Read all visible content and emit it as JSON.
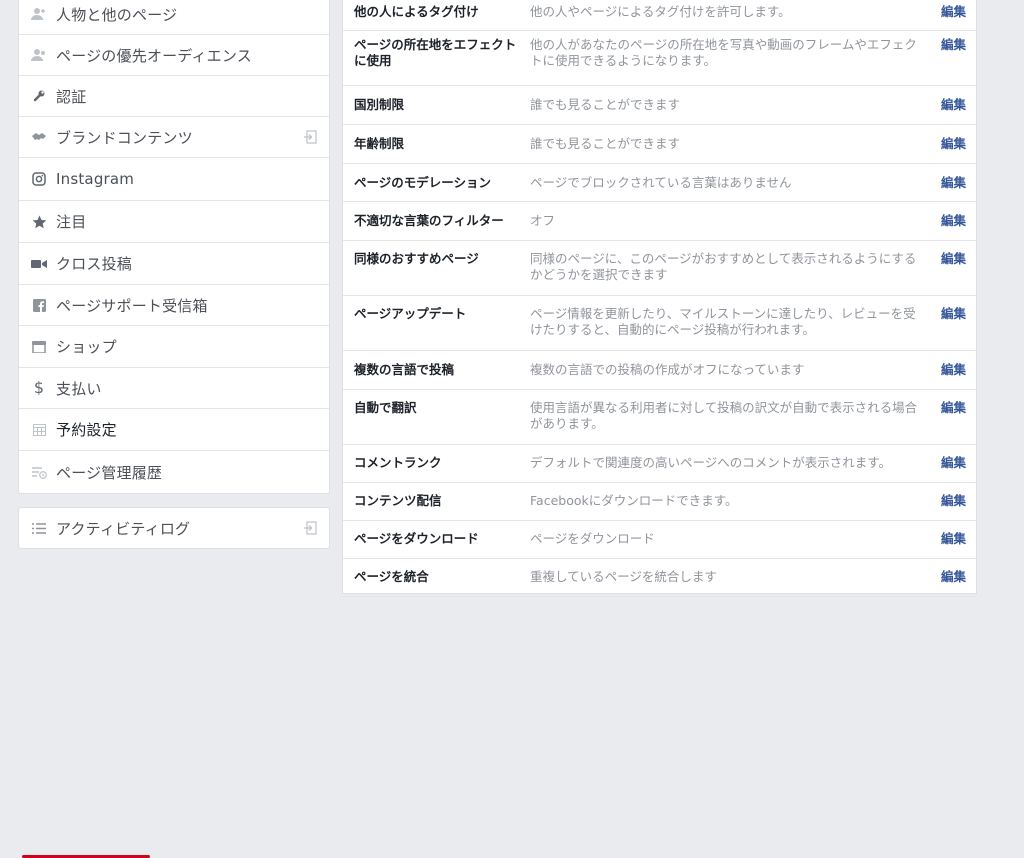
{
  "sidebar": {
    "items": [
      {
        "label": "人物と他のページ",
        "icon": "people-icon"
      },
      {
        "label": "ページの優先オーディエンス",
        "icon": "people-icon"
      },
      {
        "label": "認証",
        "icon": "wrench-icon"
      },
      {
        "label": "ブランドコンテンツ",
        "icon": "handshake-icon"
      },
      {
        "label": "Instagram",
        "icon": "instagram-icon"
      },
      {
        "label": "注目",
        "icon": "star-icon"
      },
      {
        "label": "クロス投稿",
        "icon": "video-camera-icon"
      },
      {
        "label": "ページサポート受信箱",
        "icon": "facebook-icon"
      },
      {
        "label": "ショップ",
        "icon": "shop-icon"
      },
      {
        "label": "支払い",
        "icon": "dollar-icon"
      },
      {
        "label": "予約設定",
        "icon": "calendar-icon"
      },
      {
        "label": "ページ管理履歴",
        "icon": "history-icon"
      }
    ],
    "bottom_item": {
      "label": "アクティビティログ",
      "icon": "list-icon"
    },
    "highlight_color": "#d0021b"
  },
  "settings": {
    "edit_label": "編集",
    "rows": [
      {
        "label": "他の人によるタグ付け",
        "value": "他の人やページによるタグ付けを許可します。"
      },
      {
        "label": "ページの所在地をエフェクトに使用",
        "value": "他の人があなたのページの所在地を写真や動画のフレームやエフェクトに使用できるようになります。"
      },
      {
        "label": "国別制限",
        "value": "誰でも見ることができます"
      },
      {
        "label": "年齢制限",
        "value": "誰でも見ることができます"
      },
      {
        "label": "ページのモデレーション",
        "value": "ページでブロックされている言葉はありません"
      },
      {
        "label": "不適切な言葉のフィルター",
        "value": "オフ"
      },
      {
        "label": "同様のおすすめページ",
        "value": "同様のページに、このページがおすすめとして表示されるようにするかどうかを選択できます"
      },
      {
        "label": "ページアップデート",
        "value": "ページ情報を更新したり、マイルストーンに達したり、レビューを受けたりすると、自動的にページ投稿が行われます。"
      },
      {
        "label": "複数の言語で投稿",
        "value": "複数の言語での投稿の作成がオフになっています"
      },
      {
        "label": "自動で翻訳",
        "value": "使用言語が異なる利用者に対して投稿の訳文が自動で表示される場合があります。"
      },
      {
        "label": "コメントランク",
        "value": "デフォルトで関連度の高いページへのコメントが表示されます。"
      },
      {
        "label": "コンテンツ配信",
        "value": "Facebookにダウンロードできます。"
      },
      {
        "label": "ページをダウンロード",
        "value": "ページをダウンロード"
      },
      {
        "label": "ページを統合",
        "value": "重複しているページを統合します"
      }
    ]
  }
}
